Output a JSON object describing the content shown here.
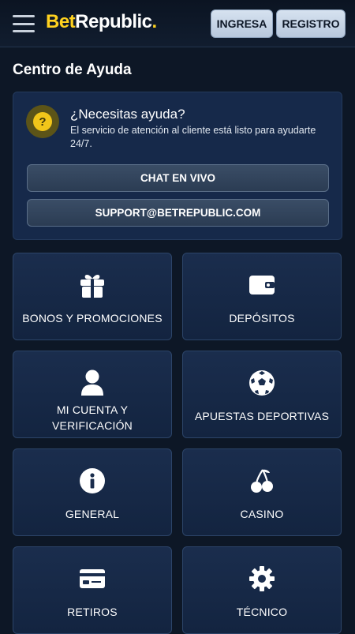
{
  "header": {
    "logo_bet": "Bet",
    "logo_rest": "Republic",
    "logo_dot": ".",
    "login_label": "INGRESA",
    "register_label": "REGISTRO"
  },
  "page": {
    "title": "Centro de Ayuda"
  },
  "help": {
    "icon": "question-icon",
    "title": "¿Necesitas ayuda?",
    "description": "El servicio de atención al cliente está listo para ayudarte 24/7.",
    "chat_label": "CHAT EN VIVO",
    "email_label": "SUPPORT@BETREPUBLIC.COM"
  },
  "categories": [
    {
      "label": "BONOS Y PROMOCIONES",
      "icon": "gift-icon"
    },
    {
      "label": "DEPÓSITOS",
      "icon": "wallet-icon"
    },
    {
      "label": "MI CUENTA Y VERIFICACIÓN",
      "icon": "user-icon"
    },
    {
      "label": "APUESTAS DEPORTIVAS",
      "icon": "soccer-ball-icon"
    },
    {
      "label": "GENERAL",
      "icon": "info-icon"
    },
    {
      "label": "CASINO",
      "icon": "cherries-icon"
    },
    {
      "label": "RETIROS",
      "icon": "card-icon"
    },
    {
      "label": "TÉCNICO",
      "icon": "gear-icon"
    }
  ],
  "colors": {
    "background": "#0d1726",
    "accent_yellow": "#ffd21f",
    "card": "#16294a",
    "header_button": "#c9d6e6"
  }
}
